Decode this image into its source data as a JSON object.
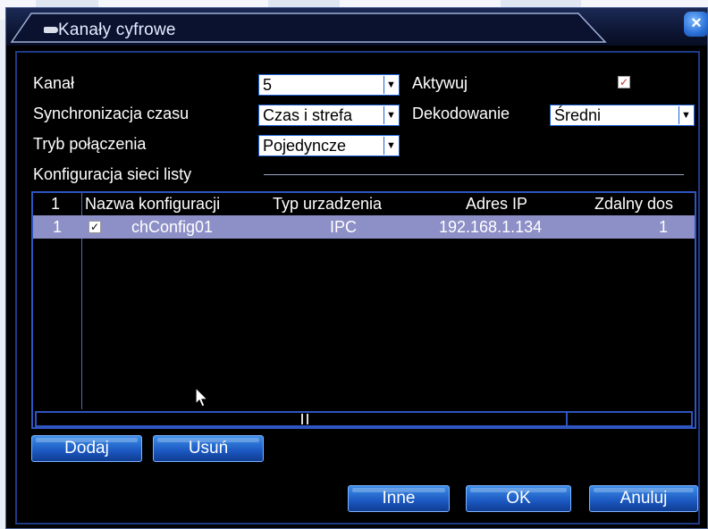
{
  "window": {
    "title": "Kanały cyfrowe",
    "close_label": "×"
  },
  "form": {
    "channel_label": "Kanał",
    "channel_value": "5",
    "activate_label": "Aktywuj",
    "activate_checked": true,
    "time_sync_label": "Synchronizacja czasu",
    "time_sync_value": "Czas i strefa",
    "decoding_label": "Dekodowanie",
    "decoding_value": "Średni",
    "connection_mode_label": "Tryb połączenia",
    "connection_mode_value": "Pojedyncze"
  },
  "section": {
    "network_config_label": "Konfiguracja sieci listy"
  },
  "table": {
    "headers": [
      "1",
      "Nazwa konfiguracji",
      "Typ urzadzenia",
      "Adres IP",
      "Zdalny dos"
    ],
    "rows": [
      {
        "index": "1",
        "checked": true,
        "name": "chConfig01",
        "device_type": "IPC",
        "ip": "192.168.1.134",
        "remote": "1"
      }
    ]
  },
  "buttons": {
    "add": "Dodaj",
    "remove": "Usuń",
    "other": "Inne",
    "ok": "OK",
    "cancel": "Anuluj"
  },
  "colors": {
    "accent_blue": "#1f64d8",
    "selected_row": "#8d8fc7",
    "panel_border": "#1f3a86"
  }
}
